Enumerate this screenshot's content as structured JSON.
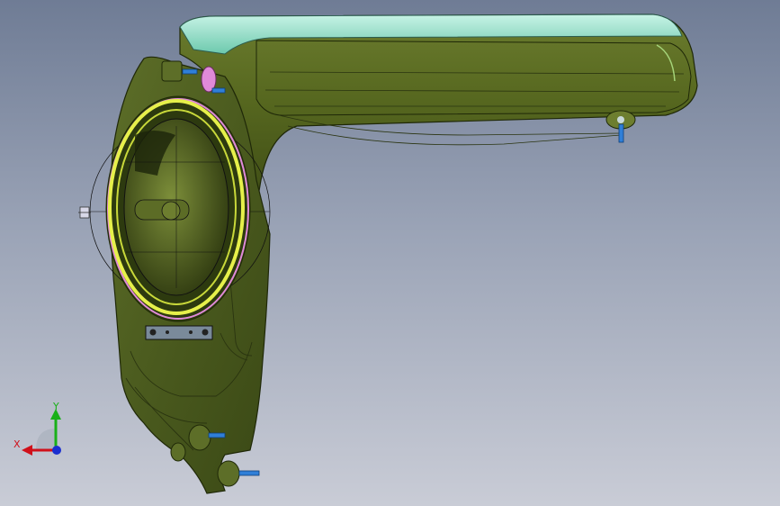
{
  "viewport": {
    "background_top": "#6f7c95",
    "background_bottom": "#c9ccd6"
  },
  "model": {
    "body_color": "#4a5a1e",
    "body_edge_color": "#1f2808",
    "duct_top_color": "#8fe0c8",
    "ring_color": "#e6f04a",
    "accent_pink": "#e08ad8",
    "pin_color": "#2f7fd8"
  },
  "triad": {
    "x_label": "X",
    "y_label": "Y",
    "x_color": "#d0101a",
    "y_color": "#18b018",
    "z_color": "#1a2fd0"
  }
}
